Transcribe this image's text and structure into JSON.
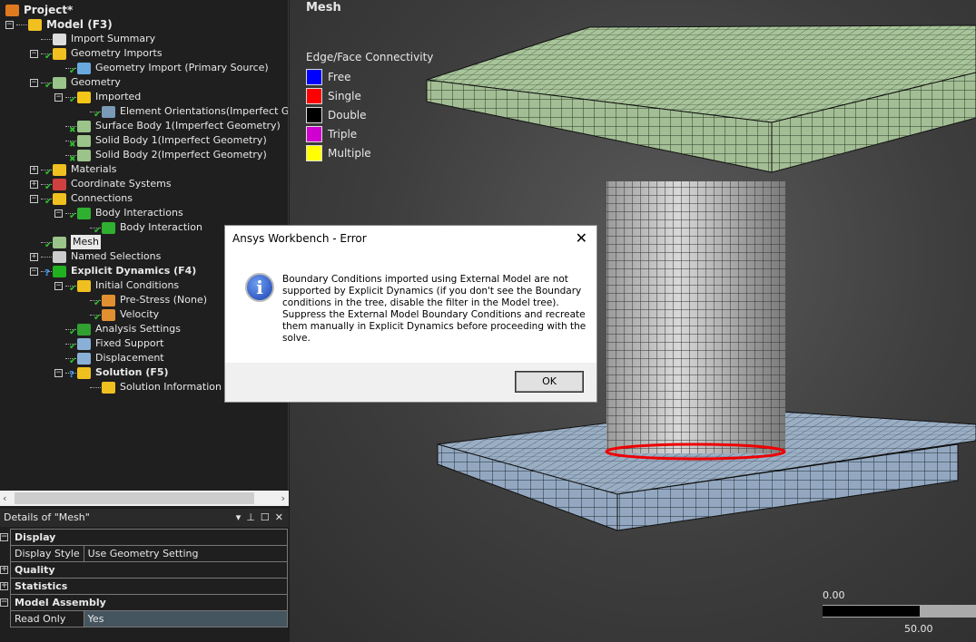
{
  "tree": [
    {
      "label": "Project*",
      "level": 0,
      "bold": true,
      "icon": "project-icon",
      "exp": "",
      "mark": ""
    },
    {
      "label": "Model (F3)",
      "level": 1,
      "bold": true,
      "icon": "model-icon",
      "exp": "-",
      "mark": ""
    },
    {
      "label": "Import Summary",
      "level": 2,
      "icon": "import-summary-icon",
      "exp": "",
      "mark": ""
    },
    {
      "label": "Geometry Imports",
      "level": 2,
      "icon": "geometry-imports-icon",
      "exp": "-",
      "mark": "check"
    },
    {
      "label": "Geometry Import (Primary Source)",
      "level": 3,
      "icon": "geometry-import-icon",
      "exp": "",
      "mark": "check"
    },
    {
      "label": "Geometry",
      "level": 2,
      "icon": "geometry-icon",
      "exp": "-",
      "mark": "check"
    },
    {
      "label": "Imported",
      "level": 3,
      "icon": "folder-icon",
      "exp": "-",
      "mark": "check"
    },
    {
      "label": "Element Orientations(Imperfect Geome",
      "level": 4,
      "icon": "element-orientation-icon",
      "exp": "",
      "mark": "check"
    },
    {
      "label": "Surface Body 1(Imperfect Geometry)",
      "level": 3,
      "icon": "surface-body-icon",
      "exp": "",
      "mark": "x"
    },
    {
      "label": "Solid Body 1(Imperfect Geometry)",
      "level": 3,
      "icon": "solid-body-icon",
      "exp": "",
      "mark": "x"
    },
    {
      "label": "Solid Body 2(Imperfect Geometry)",
      "level": 3,
      "icon": "solid-body-icon",
      "exp": "",
      "mark": "x"
    },
    {
      "label": "Materials",
      "level": 2,
      "icon": "materials-icon",
      "exp": "+",
      "mark": "check"
    },
    {
      "label": "Coordinate Systems",
      "level": 2,
      "icon": "coordinate-systems-icon",
      "exp": "+",
      "mark": "check"
    },
    {
      "label": "Connections",
      "level": 2,
      "icon": "connections-icon",
      "exp": "-",
      "mark": "check"
    },
    {
      "label": "Body Interactions",
      "level": 3,
      "icon": "body-interactions-icon",
      "exp": "-",
      "mark": "check"
    },
    {
      "label": "Body Interaction",
      "level": 4,
      "icon": "body-interaction-icon",
      "exp": "",
      "mark": "check"
    },
    {
      "label": "Mesh",
      "level": 2,
      "icon": "mesh-icon",
      "exp": "",
      "mark": "check",
      "selected": true
    },
    {
      "label": "Named Selections",
      "level": 2,
      "icon": "named-selections-icon",
      "exp": "+",
      "mark": ""
    },
    {
      "label": "Explicit Dynamics (F4)",
      "level": 2,
      "bold": true,
      "icon": "explicit-dynamics-icon",
      "exp": "-",
      "mark": "q"
    },
    {
      "label": "Initial Conditions",
      "level": 3,
      "icon": "initial-conditions-icon",
      "exp": "-",
      "mark": "check"
    },
    {
      "label": "Pre-Stress (None)",
      "level": 4,
      "icon": "t0-icon",
      "exp": "",
      "mark": "check"
    },
    {
      "label": "Velocity",
      "level": 4,
      "icon": "t0-icon",
      "exp": "",
      "mark": "check"
    },
    {
      "label": "Analysis Settings",
      "level": 3,
      "icon": "analysis-settings-icon",
      "exp": "",
      "mark": "check"
    },
    {
      "label": "Fixed Support",
      "level": 3,
      "icon": "fixed-support-icon",
      "exp": "",
      "mark": "check"
    },
    {
      "label": "Displacement",
      "level": 3,
      "icon": "displacement-icon",
      "exp": "",
      "mark": "check"
    },
    {
      "label": "Solution (F5)",
      "level": 3,
      "bold": true,
      "icon": "solution-icon",
      "exp": "-",
      "mark": "q"
    },
    {
      "label": "Solution Information",
      "level": 4,
      "icon": "solution-information-icon",
      "exp": "",
      "mark": ""
    }
  ],
  "details": {
    "title": "Details of \"Mesh\"",
    "rows": [
      {
        "type": "group",
        "label": "Display",
        "exp": "-"
      },
      {
        "type": "prop",
        "label": "Display Style",
        "value": "Use Geometry Setting"
      },
      {
        "type": "group",
        "label": "Quality",
        "exp": "+"
      },
      {
        "type": "group",
        "label": "Statistics",
        "exp": "+"
      },
      {
        "type": "group",
        "label": "Model Assembly",
        "exp": "-"
      },
      {
        "type": "prop",
        "label": "Read Only",
        "value": "Yes",
        "highlight": true
      }
    ]
  },
  "viewport": {
    "title": "Mesh",
    "legend_title": "Edge/Face Connectivity",
    "legend": [
      {
        "label": "Free",
        "color": "#0000ff"
      },
      {
        "label": "Single",
        "color": "#ff0000"
      },
      {
        "label": "Double",
        "color": "#000000"
      },
      {
        "label": "Triple",
        "color": "#d000d0"
      },
      {
        "label": "Multiple",
        "color": "#ffff00"
      }
    ],
    "scale_min": "0.00",
    "scale_mid": "50.00"
  },
  "dialog": {
    "title": "Ansys Workbench - Error",
    "message": "Boundary Conditions imported using External Model are not supported by Explicit Dynamics (if you don't see the Boundary conditions in the tree, disable the filter in the Model tree). Suppress the External Model Boundary Conditions and recreate them manually in Explicit Dynamics before proceeding with the solve.",
    "ok_label": "OK",
    "close_glyph": "✕",
    "icon": "info-icon"
  }
}
